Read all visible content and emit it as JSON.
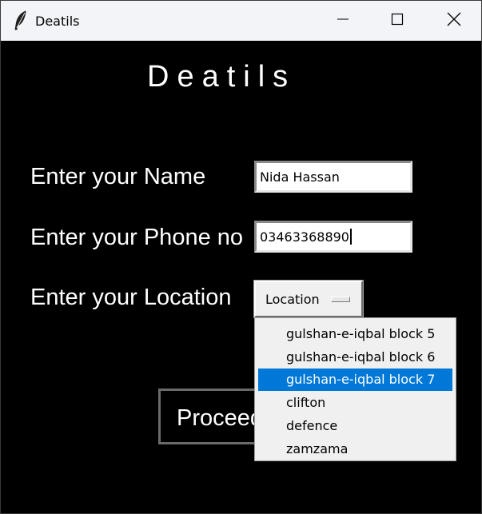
{
  "window": {
    "title": "Deatils"
  },
  "heading": "Deatils",
  "form": {
    "name_label": "Enter your Name",
    "name_value": "Nida Hassan",
    "phone_label": "Enter your Phone no",
    "phone_value": "03463368890",
    "location_label": "Enter your Location",
    "location_selected": "Location",
    "proceed_label": "Proceed"
  },
  "location_options": [
    "gulshan-e-iqbal block 5",
    "gulshan-e-iqbal block 6",
    "gulshan-e-iqbal block 7",
    "clifton",
    "defence",
    "zamzama"
  ],
  "highlighted_option": "gulshan-e-iqbal block 7",
  "icons": {
    "app": "feather-icon",
    "minimize": "minimize-icon",
    "maximize": "maximize-icon",
    "close": "close-icon"
  },
  "colors": {
    "background": "#000000",
    "titlebar": "#f3f4f8",
    "highlight": "#0078d7",
    "text": "#ffffff"
  }
}
